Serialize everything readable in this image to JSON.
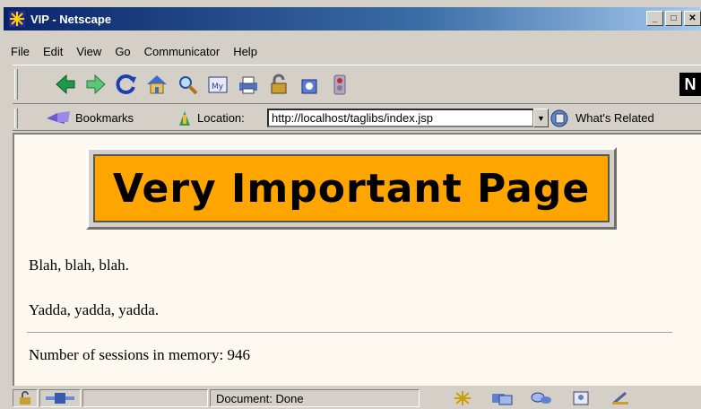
{
  "window": {
    "title": "VIP - Netscape"
  },
  "menu": [
    "File",
    "Edit",
    "View",
    "Go",
    "Communicator",
    "Help"
  ],
  "nav_icons": [
    "back-icon",
    "forward-icon",
    "reload-icon",
    "home-icon",
    "search-icon",
    "my-netscape-icon",
    "print-icon",
    "security-icon",
    "shop-icon",
    "stop-icon"
  ],
  "location_bar": {
    "bookmarks_label": "Bookmarks",
    "location_label": "Location:",
    "url": "http://localhost/taglibs/index.jsp",
    "related_label": "What's Related"
  },
  "page": {
    "banner": "Very Important Page",
    "paragraphs": [
      "Blah, blah, blah.",
      "Yadda, yadda, yadda."
    ],
    "footer": "Number of sessions in memory: 946"
  },
  "status": {
    "text": "Document: Done"
  },
  "colors": {
    "banner": "#ffa500",
    "titlebar": "#0a246a",
    "page_bg": "#fdf9f1"
  }
}
